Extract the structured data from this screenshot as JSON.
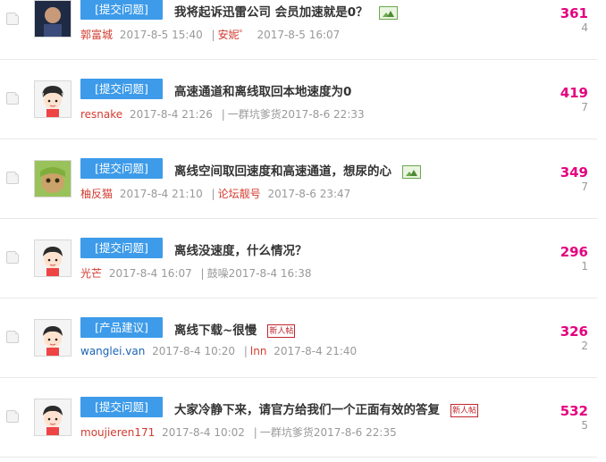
{
  "threads": [
    {
      "tag": "[提交问题]",
      "title": "我将起诉迅雷公司 会员加速就是0？",
      "author": "郭富城",
      "post_time": "2017-8-5 15:40",
      "last_replier": "安妮゜",
      "last_time": "2017-8-5 16:07",
      "views": "361",
      "replies": "4",
      "has_image_icon": true,
      "newbie": false
    },
    {
      "tag": "[提交问题]",
      "title": "高速通道和离线取回本地速度为0",
      "author": "resnake",
      "post_time": "2017-8-4 21:26",
      "last_replier": "一群坑爹货",
      "last_time": "2017-8-6 22:33",
      "views": "419",
      "replies": "7",
      "has_image_icon": false,
      "newbie": false
    },
    {
      "tag": "[提交问题]",
      "title": "离线空间取回速度和高速通道，想尿的心",
      "author": "柚反猫",
      "post_time": "2017-8-4 21:10",
      "last_replier": "论坛靓号",
      "last_time": "2017-8-6 23:47",
      "views": "349",
      "replies": "7",
      "has_image_icon": true,
      "newbie": false
    },
    {
      "tag": "[提交问题]",
      "title": "离线没速度，什么情况？",
      "author": "光芒",
      "post_time": "2017-8-4 16:07",
      "last_replier": "鼓噪",
      "last_time": "2017-8-4 16:38",
      "views": "296",
      "replies": "1",
      "has_image_icon": false,
      "newbie": false
    },
    {
      "tag": "[产品建议]",
      "title": "离线下载~很慢",
      "author": "wanglei.van",
      "post_time": "2017-8-4 10:20",
      "last_replier": "lnn",
      "last_time": "2017-8-4 21:40",
      "views": "326",
      "replies": "2",
      "has_image_icon": false,
      "newbie": true
    },
    {
      "tag": "[提交问题]",
      "title": "大家冷静下来，请官方给我们一个正面有效的答复",
      "author": "moujieren171",
      "post_time": "2017-8-4 10:02",
      "last_replier": "一群坑爹货",
      "last_time": "2017-8-6 22:35",
      "views": "532",
      "replies": "5",
      "has_image_icon": false,
      "newbie": true
    }
  ],
  "newbie_label": "新人帖",
  "colors": {
    "tag_bg": "#3d9be9",
    "views": "#e4007f",
    "author": "#d23b2f"
  }
}
